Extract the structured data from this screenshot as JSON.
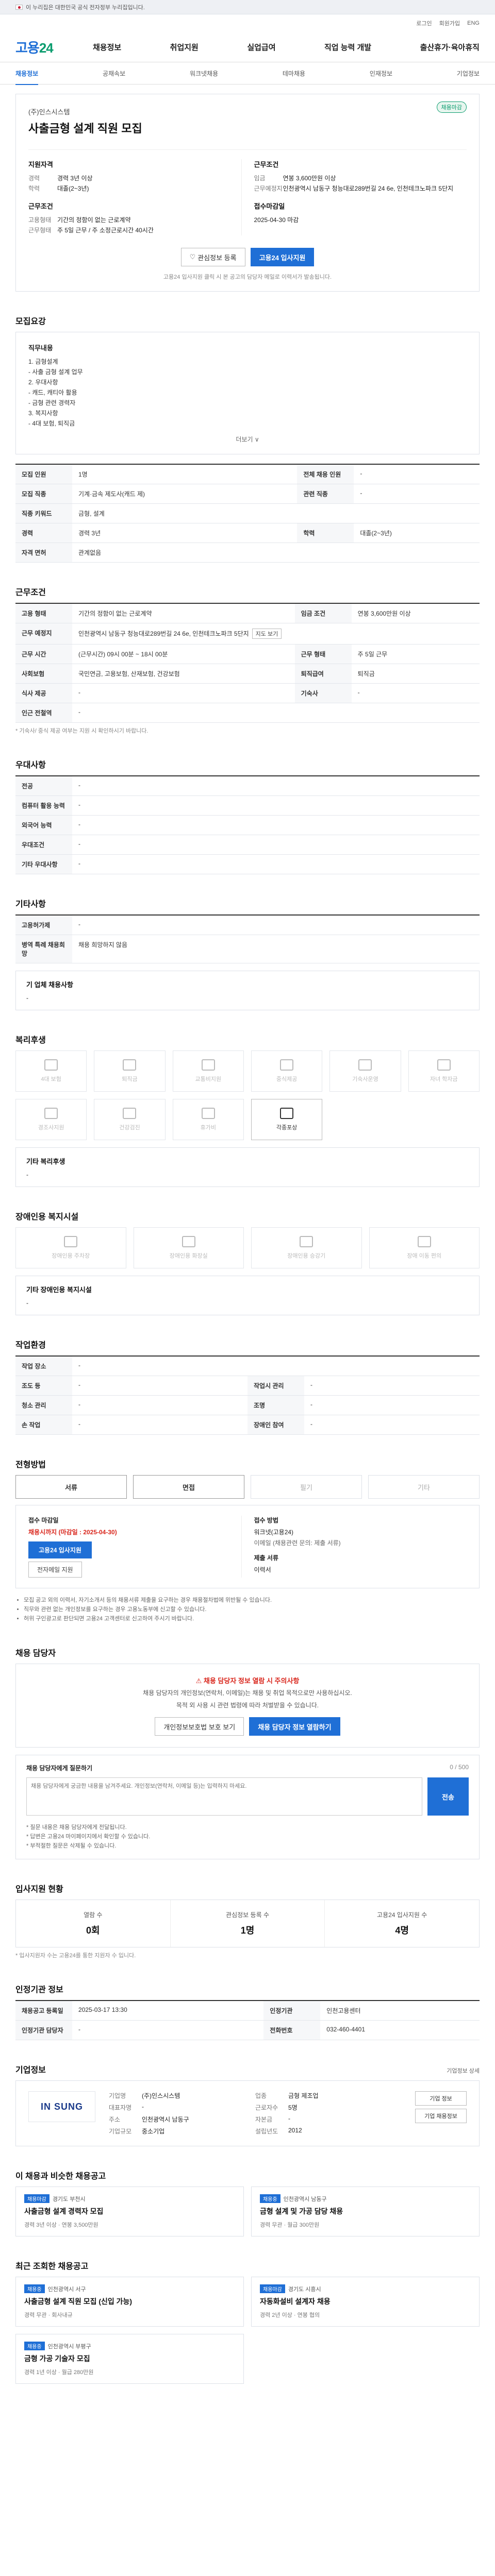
{
  "gov_banner": {
    "text": "이 누리집은 대한민국 공식 전자정부 누리집입니다."
  },
  "util": {
    "items": [
      "로그인",
      "회원가입",
      "ENG"
    ]
  },
  "header": {
    "logo_main": "고용",
    "logo_sub": "24",
    "gnb": [
      "채용정보",
      "취업지원",
      "실업급여",
      "직업 능력 개발",
      "출산휴가·육아휴직"
    ]
  },
  "subtabs": [
    "채용정보",
    "공채속보",
    "워크넷채용",
    "테마채용",
    "인재정보",
    "기업정보"
  ],
  "job": {
    "badge": "채용마감",
    "company": "(주)인스시스템",
    "title": "사출금형 설계 직원 모집",
    "left": {
      "qual_title": "지원자격",
      "qual": [
        {
          "k": "경력",
          "v": "경력 3년 이상"
        },
        {
          "k": "학력",
          "v": "대졸(2~3년)"
        }
      ],
      "cond_title": "근무조건",
      "cond": [
        {
          "k": "고용형태",
          "v": "기간의 정함이 없는 근로계약"
        },
        {
          "k": "근무형태",
          "v": "주 5일 근무 / 주 소정근로시간 40시간"
        }
      ]
    },
    "right": {
      "pay_title": "근무조건",
      "pay": [
        {
          "k": "임금",
          "v": "연봉 3,600만원 이상"
        },
        {
          "k": "근무예정지",
          "v": "인천광역시 남동구 청능대로289번길 24 6e, 인천테크노파크 5단지"
        }
      ],
      "due_title": "접수마감일",
      "due": "2025-04-30 마감"
    },
    "btn_scrap": "관심정보 등록",
    "btn_apply": "고용24 입사지원",
    "btn_note": "고용24 입사지원 클릭 시 본 공고의 담당자 메일로 이력서가 발송됩니다."
  },
  "duty": {
    "section": "모집요강",
    "head": "직무내용",
    "lines": [
      "1. 금형설계",
      " - 사출 금형 설계 업무",
      "2. 우대사항",
      " - 캐드, 캐티아 활용",
      " - 금형 관련 경력자",
      "3. 복지사항",
      " - 4대 보험, 퇴직금"
    ],
    "more": "더보기 ∨"
  },
  "basic_table": [
    [
      "모집 인원",
      "1명",
      "전체 채용 인원",
      "-"
    ],
    [
      "모집 직종",
      "기계·금속 제도사(캐드 제)",
      "관련 직종",
      "-"
    ],
    [
      "직종 키워드",
      "금형, 설계",
      "",
      ""
    ],
    [
      "경력",
      "경력 3년",
      "학력",
      "대졸(2~3년)"
    ],
    [
      "자격 면허",
      "관계없음",
      "",
      ""
    ]
  ],
  "cond_section": "근무조건",
  "cond_table": [
    [
      "고용 형태",
      "기간의 정함이 없는 근로계약",
      "임금 조건",
      "연봉 3,600만원 이상"
    ],
    [
      "근무 예정지",
      "인천광역시 남동구 청능대로289번길 24 6e, 인천테크노파크 5단지",
      "",
      ""
    ],
    [
      "근무 시간",
      "(근무시간) 09시 00분 ~ 18시 00분",
      "근무 형태",
      "주 5일 근무"
    ],
    [
      "사회보험",
      "국민연금, 고용보험, 산재보험, 건강보험",
      "퇴직급여",
      "퇴직금"
    ],
    [
      "식사 제공",
      "-",
      "기숙사",
      "-"
    ],
    [
      "인근 전철역",
      "-",
      "",
      ""
    ]
  ],
  "cond_map_btn": "지도 보기",
  "cond_notice": "* 기숙사/ 중식 제공 여부는 지원 시 확인하시기 바랍니다.",
  "pref_section": "우대사항",
  "pref_table": [
    [
      "전공",
      "-"
    ],
    [
      "컴퓨터 활용 능력",
      "-"
    ],
    [
      "외국어 능력",
      "-"
    ],
    [
      "우대조건",
      "-"
    ],
    [
      "기타 우대사항",
      "-"
    ]
  ],
  "etc_section": "기타사항",
  "etc_table": [
    [
      "고용허가제",
      "-"
    ],
    [
      "병역 특례 채용희망",
      "채용 희망하지 않음"
    ]
  ],
  "etc_note_title": "기 업체 채용사항",
  "etc_note": "-",
  "welfare_section": "복리후생",
  "welfare": [
    {
      "label": "4대 보험",
      "on": false
    },
    {
      "label": "퇴직금",
      "on": false
    },
    {
      "label": "교통비지원",
      "on": false
    },
    {
      "label": "중식제공",
      "on": false
    },
    {
      "label": "기숙사운영",
      "on": false
    },
    {
      "label": "자녀 학자금",
      "on": false
    },
    {
      "label": "경조사지원",
      "on": false
    },
    {
      "label": "건강검진",
      "on": false
    },
    {
      "label": "휴가비",
      "on": false
    },
    {
      "label": "각종포상",
      "on": true
    }
  ],
  "welfare_note_title": "기타 복리후생",
  "welfare_note": "-",
  "disab_section": "장애인용 복지시설",
  "disab": [
    {
      "label": "장애인용 주차장",
      "on": false
    },
    {
      "label": "장애인용 화장실",
      "on": false
    },
    {
      "label": "장애인용 승강기",
      "on": false
    },
    {
      "label": "장애 이동 편의",
      "on": false
    }
  ],
  "disab_note_title": "기타 장애인용 복지시설",
  "disab_note": "-",
  "env_section": "작업환경",
  "env_table": [
    [
      "작업 장소",
      "-",
      "",
      ""
    ],
    [
      "조도 등",
      "-",
      "작업시 관리",
      "-"
    ],
    [
      "청소 관리",
      "-",
      "조명",
      "-"
    ],
    [
      "손 작업",
      "-",
      "장애인 참여",
      "-"
    ]
  ],
  "process_section": "전형방법",
  "process_steps": [
    {
      "label": "서류",
      "on": true
    },
    {
      "label": "면접",
      "on": true
    },
    {
      "label": "필기",
      "on": false
    },
    {
      "label": "기타",
      "on": false
    }
  ],
  "apply": {
    "left_cap": "접수 마감일",
    "left_date": "채용시까지 (마감일 : 2025-04-30)",
    "left_btn": "고용24 입사지원",
    "left_btn2": "전자메일 지원",
    "right_cap": "접수 방법",
    "right_v": "워크넷(고용24)",
    "right_sub": "이메일 (채용관련 문의: 제출 서류)",
    "docs_cap": "제출 서류",
    "docs": "이력서"
  },
  "apply_bullets": [
    "모집 공고 외의 이력서, 자기소개서 등의 채용서류 제출을 요구하는 경우 채용절차법에 위반될 수 있습니다.",
    "직무와 관련 없는 개인정보를 요구하는 경우 고용노동부에 신고할 수 있습니다.",
    "허위 구인광고로 판단되면 고용24 고객센터로 신고하여 주시기 바랍니다."
  ],
  "manager_section": "채용 담당자",
  "manager": {
    "alert": "채용 담당자 정보 열람 시 주의사항",
    "sub1": "채용 담당자의 개인정보(연락처, 이메일)는 채용 및 취업 목적으로만 사용하십시오.",
    "sub2": "목적 외 사용 시 관련 법령에 따라 처벌받을 수 있습니다.",
    "btn1": "개인정보보호법 보호 보기",
    "btn2": "채용 담당자 정보 열람하기"
  },
  "inquiry": {
    "head": "채용 담당자에게 질문하기",
    "count": "0 / 500",
    "placeholder": "채용 담당자에게 궁금한 내용을 남겨주세요. 개인정보(연락처, 이메일 등)는 입력하지 마세요.",
    "send": "전송",
    "notes": [
      "* 질문 내용은 채용 담당자에게 전달됩니다.",
      "* 답변은 고용24 마이페이지에서 확인할 수 있습니다.",
      "* 부적절한 질문은 삭제될 수 있습니다."
    ]
  },
  "stats_section": "입사지원 현황",
  "stats": [
    {
      "label": "열람 수",
      "num": "0회"
    },
    {
      "label": "관심정보 등록 수",
      "num": "1명"
    },
    {
      "label": "고용24 입사지원 수",
      "num": "4명"
    }
  ],
  "stats_note": "* 입사지원자 수는 고용24를 통한 지원자 수 입니다.",
  "agency_section": "인정기관 정보",
  "agency_table": [
    [
      "채용공고 등록일",
      "2025-03-17 13:30",
      "인정기관",
      "인천고용센터"
    ],
    [
      "인정기관 담당자",
      "-",
      "전화번호",
      "032-460-4401"
    ]
  ],
  "company_section": "기업정보",
  "company_more": "기업정보 상세",
  "company": {
    "logo": "IN SUNG",
    "info": [
      [
        "기업명",
        "(주)인스시스템"
      ],
      [
        "업종",
        "금형 제조업"
      ],
      [
        "대표자명",
        "-"
      ],
      [
        "근로자수",
        "5명"
      ],
      [
        "주소",
        "인천광역시 남동구"
      ],
      [
        "자본금",
        "-"
      ],
      [
        "기업규모",
        "중소기업"
      ],
      [
        "설립년도",
        "2012"
      ]
    ],
    "btns": [
      "기업 정보",
      "기업 채용정보"
    ]
  },
  "similar_section": "이 채용과 비슷한 채용공고",
  "similar": [
    {
      "tag": "채용마감",
      "co": "경기도 부천시",
      "title": "사출금형 설계 경력자 모집",
      "meta": "경력 3년 이상 · 연봉 3,500만원"
    },
    {
      "tag": "채용중",
      "co": "인천광역시 남동구",
      "title": "금형 설계 및 가공 담당 채용",
      "meta": "경력 무관 · 월급 300만원"
    }
  ],
  "recent_section": "최근 조회한 채용공고",
  "recent": [
    {
      "tag": "채용중",
      "co": "인천광역시 서구",
      "title": "사출금형 설계 직원 모집 (신입 가능)",
      "meta": "경력 무관 · 회사내규"
    },
    {
      "tag": "채용마감",
      "co": "경기도 시흥시",
      "title": "자동화설비 설계자 채용",
      "meta": "경력 2년 이상 · 연봉 협의"
    },
    {
      "tag": "채용중",
      "co": "인천광역시 부평구",
      "title": "금형 가공 기술자 모집",
      "meta": "경력 1년 이상 · 월급 280만원"
    }
  ]
}
